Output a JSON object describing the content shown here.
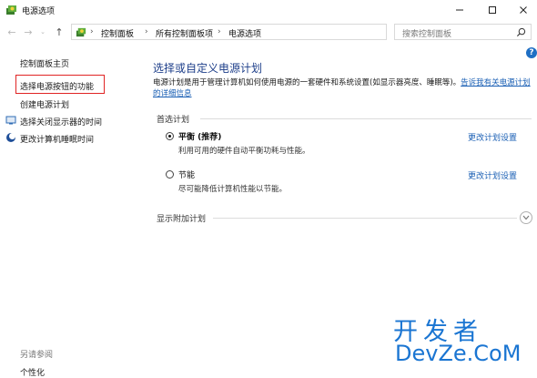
{
  "window": {
    "title": "电源选项",
    "min_glyph": "—",
    "max_glyph": "☐",
    "close_glyph": "✕"
  },
  "address": {
    "crumbs": [
      "控制面板",
      "所有控制面板项",
      "电源选项"
    ],
    "sep": "›",
    "search_placeholder": "搜索控制面板"
  },
  "sidebar": {
    "home": "控制面板主页",
    "items": [
      {
        "label": "选择电源按钮的功能"
      },
      {
        "label": "创建电源计划"
      },
      {
        "label": "选择关闭显示器的时间"
      },
      {
        "label": "更改计算机睡眠时间"
      }
    ],
    "see_also": "另请参阅",
    "personalize": "个性化"
  },
  "main": {
    "title": "选择或自定义电源计划",
    "desc_text": "电源计划是用于管理计算机如何使用电源的一套硬件和系统设置(如显示器亮度、睡眠等)。",
    "desc_link": "告诉我有关电源计划的详细信息",
    "preferred_label": "首选计划",
    "plans": [
      {
        "name": "平衡 (推荐)",
        "desc": "利用可用的硬件自动平衡功耗与性能。",
        "change": "更改计划设置",
        "selected": true
      },
      {
        "name": "节能",
        "desc": "尽可能降低计算机性能以节能。",
        "change": "更改计划设置",
        "selected": false
      }
    ],
    "extra_label": "显示附加计划"
  },
  "help_glyph": "?",
  "watermark": {
    "top": "开发者",
    "bottom": "DevZe.CoM"
  },
  "colors": {
    "link": "#1a5fb4",
    "title_blue": "#1e3f8a",
    "highlight_red": "#e02424",
    "watermark": "#1a75d2"
  }
}
